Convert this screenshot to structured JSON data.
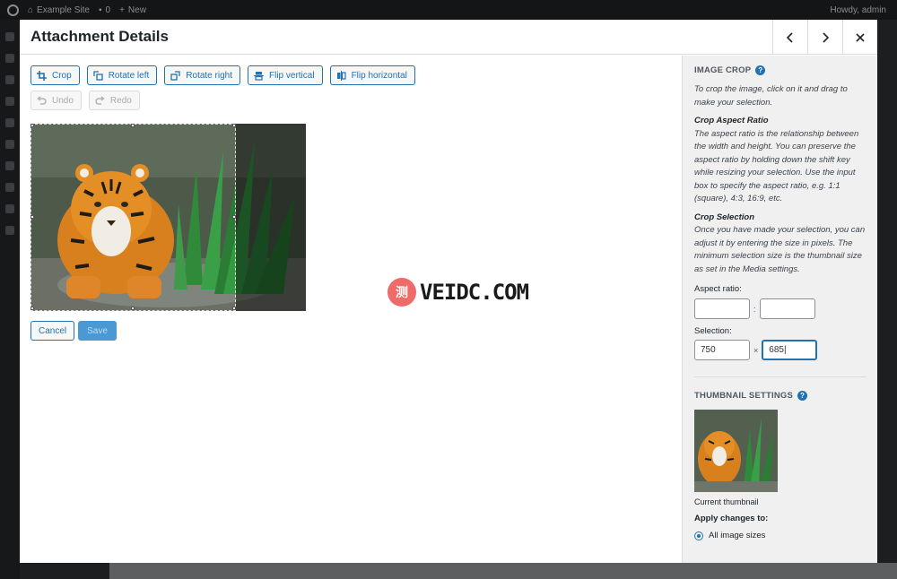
{
  "adminbar": {
    "site_name": "Example Site",
    "comments_count": "0",
    "new_label": "New",
    "greeting": "Howdy, admin"
  },
  "modal": {
    "title": "Attachment Details",
    "prev_icon": "chevron-left-icon",
    "next_icon": "chevron-right-icon",
    "close_icon": "close-icon"
  },
  "toolbar": {
    "crop": "Crop",
    "rotate_left": "Rotate left",
    "rotate_right": "Rotate right",
    "flip_vertical": "Flip vertical",
    "flip_horizontal": "Flip horizontal",
    "undo": "Undo",
    "redo": "Redo"
  },
  "actions": {
    "cancel": "Cancel",
    "save": "Save"
  },
  "watermark": {
    "mark": "测",
    "text": "VEIDC.COM"
  },
  "panel": {
    "image_crop_title": "Image Crop",
    "intro": "To crop the image, click on it and drag to make your selection.",
    "aspect_heading": "Crop Aspect Ratio",
    "aspect_text": "The aspect ratio is the relationship between the width and height. You can preserve the aspect ratio by holding down the shift key while resizing your selection. Use the input box to specify the aspect ratio, e.g. 1:1 (square), 4:3, 16:9, etc.",
    "selection_heading": "Crop Selection",
    "selection_text": "Once you have made your selection, you can adjust it by entering the size in pixels. The minimum selection size is the thumbnail size as set in the Media settings.",
    "aspect_label": "Aspect ratio:",
    "aspect_w": "",
    "aspect_h": "",
    "aspect_sep": ":",
    "selection_label": "Selection:",
    "selection_w": "750",
    "selection_h": "685",
    "selection_sep": "×",
    "thumbnail_title": "Thumbnail Settings",
    "current_thumbnail": "Current thumbnail",
    "apply_label": "Apply changes to:",
    "apply_option": "All image sizes"
  },
  "colors": {
    "accent": "#2271b1",
    "panel_bg": "#f0f0f1"
  }
}
